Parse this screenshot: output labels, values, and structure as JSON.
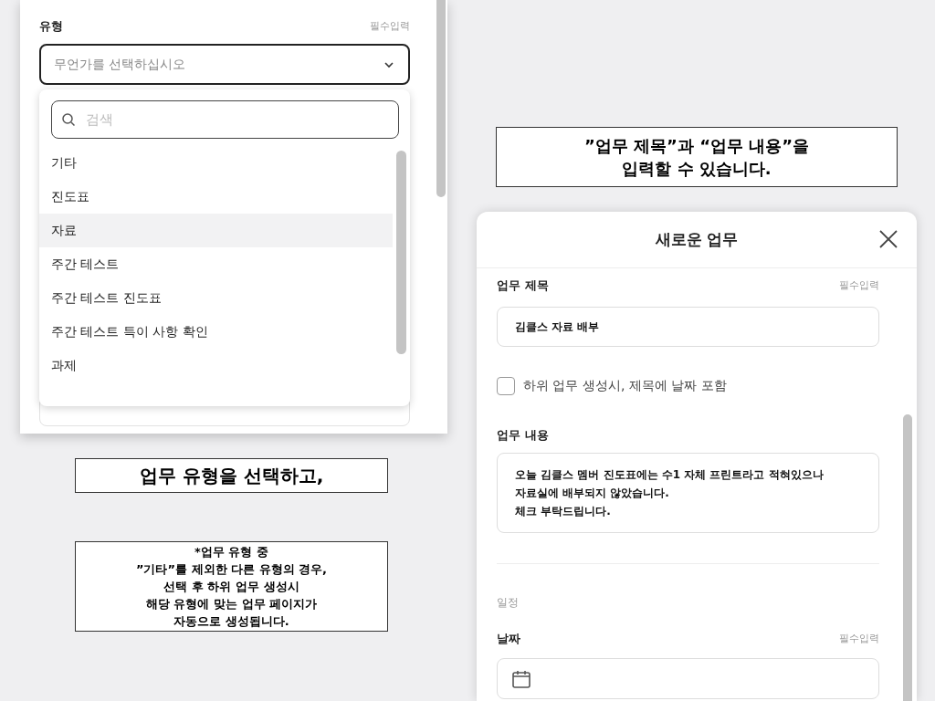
{
  "type_panel": {
    "label": "유형",
    "required": "필수입력",
    "select": {
      "placeholder": "무언가를 선택하십시오"
    },
    "dropdown": {
      "search": {
        "placeholder": "검색"
      },
      "options": [
        {
          "label": "기타",
          "selected": false
        },
        {
          "label": "진도표",
          "selected": false
        },
        {
          "label": "자료",
          "selected": true
        },
        {
          "label": "주간 테스트",
          "selected": false
        },
        {
          "label": "주간 테스트 진도표",
          "selected": false
        },
        {
          "label": "주간 테스트 특이 사항 확인",
          "selected": false
        },
        {
          "label": "과제",
          "selected": false
        }
      ]
    }
  },
  "left_captions": [
    {
      "kind": "heading",
      "text": "업무 유형을 선택하고,"
    },
    {
      "kind": "note",
      "text": "*업무 유형 중\n”기타”를 제외한 다른 유형의 경우,\n선택 후 하위 업무 생성시\n해당 유형에 맞는 업무 페이지가\n자동으로 생성됩니다."
    }
  ],
  "right_caption": {
    "text": "”업무 제목”과 “업무 내용”을\n입력할 수 있습니다."
  },
  "modal": {
    "title": "새로운 업무",
    "task_title": {
      "label": "업무 제목",
      "required": "필수입력",
      "value": "김클스 자료 배부"
    },
    "checkbox": {
      "label": "하위 업무 생성시, 제목에 날짜 포함",
      "checked": false
    },
    "task_content": {
      "label": "업무 내용",
      "value": "오늘 김클스 멤버 진도표에는 수1 자체 프린트라고 적혀있으나\n자료실에 배부되지 않았습니다.\n체크 부탁드립니다."
    },
    "schedule": {
      "heading": "일정",
      "date": {
        "label": "날짜",
        "required": "필수입력"
      }
    }
  }
}
